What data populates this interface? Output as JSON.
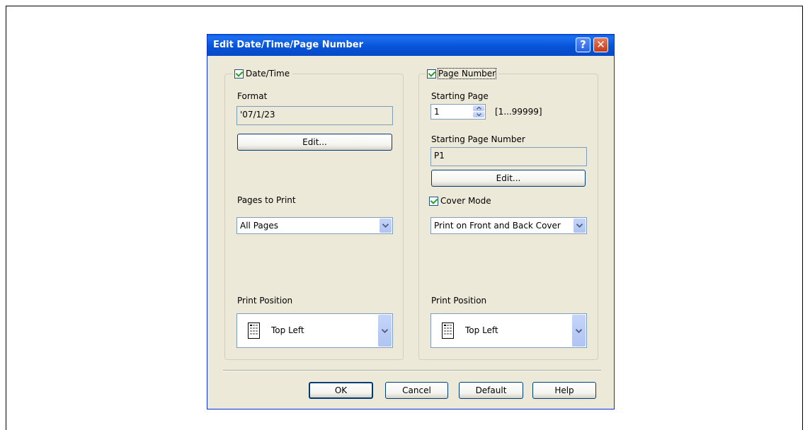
{
  "dialog": {
    "title": "Edit Date/Time/Page Number",
    "help_glyph": "?",
    "close_glyph": "✕"
  },
  "date_time": {
    "legend": "Date/Time",
    "checked": true,
    "format_label": "Format",
    "format_value": "'07/1/23",
    "edit_label": "Edit...",
    "pages_to_print_label": "Pages to Print",
    "pages_to_print_value": "All Pages",
    "print_position_label": "Print Position",
    "print_position_value": "Top Left"
  },
  "page_number": {
    "legend": "Page Number",
    "checked": true,
    "starting_page_label": "Starting Page",
    "starting_page_value": "1",
    "starting_page_range": "[1...99999]",
    "starting_page_number_label": "Starting Page Number",
    "starting_page_number_value": "P1",
    "edit_label": "Edit...",
    "cover_mode_label": "Cover Mode",
    "cover_mode_checked": true,
    "cover_mode_value": "Print on Front and Back Cover",
    "print_position_label": "Print Position",
    "print_position_value": "Top Left"
  },
  "footer": {
    "ok": "OK",
    "cancel": "Cancel",
    "default": "Default",
    "help": "Help"
  }
}
